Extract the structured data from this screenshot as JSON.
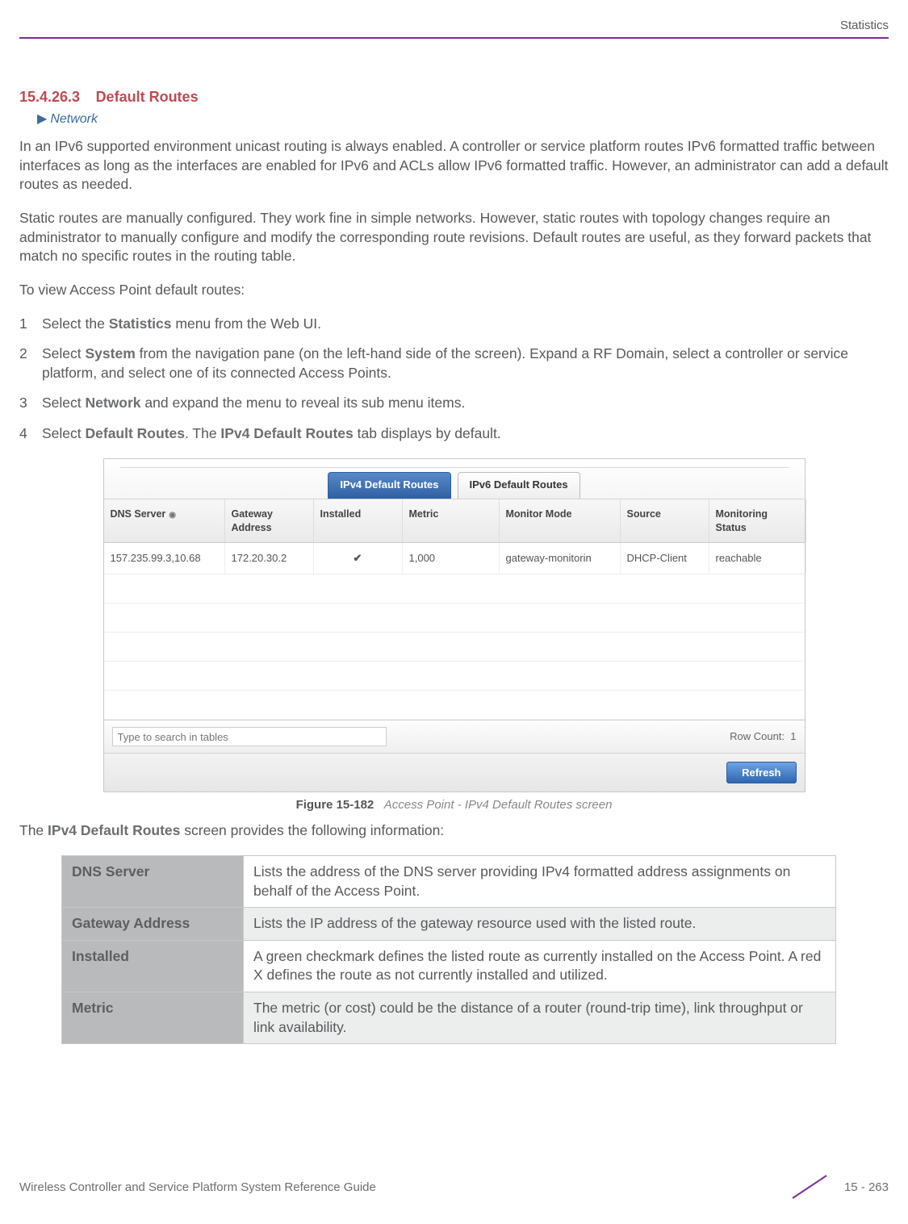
{
  "header": {
    "section_label": "Statistics"
  },
  "section": {
    "number": "15.4.26.3",
    "title": "Default Routes",
    "breadcrumb_arrow": "▶",
    "breadcrumb": "Network"
  },
  "paragraphs": {
    "p1": "In an IPv6 supported environment unicast routing is always enabled. A controller or service platform routes IPv6 formatted traffic between interfaces as long as the interfaces are enabled for IPv6 and ACLs allow IPv6 formatted traffic. However, an administrator can add a default routes as needed.",
    "p2": "Static routes are manually configured. They work fine in simple networks. However, static routes with topology changes require an administrator to manually configure and modify the corresponding route revisions. Default routes are useful, as they forward packets that match no specific routes in the routing table.",
    "p3": "To view Access Point default routes:"
  },
  "steps": {
    "s1_pre": "Select the ",
    "s1_bold": "Statistics",
    "s1_post": " menu from the Web UI.",
    "s2_pre": "Select ",
    "s2_bold": "System",
    "s2_post": " from the navigation pane (on the left-hand side of the screen). Expand a RF Domain, select a controller or service platform, and select one of its connected Access Points.",
    "s3_pre": "Select ",
    "s3_bold": "Network",
    "s3_post": " and expand the menu to reveal its sub menu items.",
    "s4_pre": "Select ",
    "s4_bold1": "Default Routes",
    "s4_mid": ". The ",
    "s4_bold2": "IPv4 Default Routes",
    "s4_post": " tab displays by default."
  },
  "screenshot": {
    "tabs": {
      "active": "IPv4 Default Routes",
      "inactive": "IPv6 Default Routes"
    },
    "columns": {
      "c0": "DNS Server",
      "c1": "Gateway Address",
      "c2": "Installed",
      "c3": "Metric",
      "c4": "Monitor Mode",
      "c5": "Source",
      "c6": "Monitoring Status"
    },
    "row": {
      "dns": "157.235.99.3,10.68",
      "gw": "172.20.30.2",
      "installed_icon": "✔",
      "metric": "1,000",
      "monitor": "gateway-monitorin",
      "source": "DHCP-Client",
      "status": "reachable"
    },
    "search_placeholder": "Type to search in tables",
    "row_count_label": "Row Count:",
    "row_count_value": "1",
    "refresh_label": "Refresh"
  },
  "figure": {
    "label": "Figure 15-182",
    "caption": "Access Point - IPv4 Default Routes screen"
  },
  "after_fig": {
    "pre": "The ",
    "bold": "IPv4 Default Routes",
    "post": " screen provides the following information:"
  },
  "desc_table": {
    "r1k": "DNS Server",
    "r1v": "Lists the address of the DNS server providing IPv4 formatted address assignments on behalf of the Access Point.",
    "r2k": "Gateway Address",
    "r2v": "Lists the IP address of the gateway resource used with the listed route.",
    "r3k": "Installed",
    "r3v": "A green checkmark defines the listed route as currently installed on the Access Point. A red X defines the route as not currently installed and utilized.",
    "r4k": "Metric",
    "r4v": "The metric (or cost) could be the distance of a router (round-trip time), link throughput or link availability."
  },
  "footer": {
    "doc_title": "Wireless Controller and Service Platform System Reference Guide",
    "page": "15 - 263"
  }
}
